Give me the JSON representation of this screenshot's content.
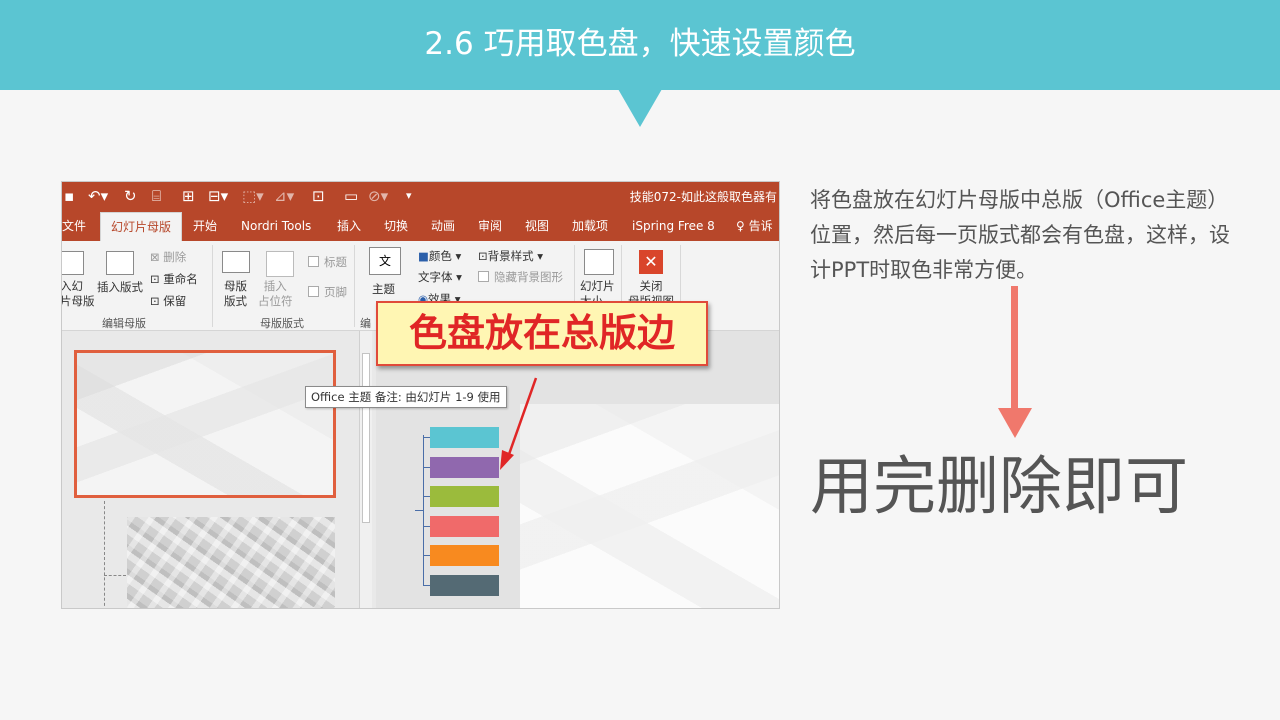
{
  "slide": {
    "title": "2.6 巧用取色盘，快速设置颜色",
    "description": "将色盘放在幻灯片母版中总版（Office主题） 位置，然后每一页版式都会有色盘，这样，设计PPT时取色非常方便。",
    "conclusion": "用完删除即可",
    "accent_color": "#5bc5d2",
    "arrow_color": "#f0786c"
  },
  "app": {
    "document_title": "技能072-如此这般取色器有",
    "quick_access": [
      "save-icon",
      "undo-icon",
      "redo-icon",
      "present-icon",
      "layout-icon",
      "format-painter-icon"
    ],
    "tabs": [
      {
        "label": "文件"
      },
      {
        "label": "幻灯片母版",
        "active": true
      },
      {
        "label": "开始"
      },
      {
        "label": "Nordri Tools"
      },
      {
        "label": "插入"
      },
      {
        "label": "切换"
      },
      {
        "label": "动画"
      },
      {
        "label": "审阅"
      },
      {
        "label": "视图"
      },
      {
        "label": "加载项"
      },
      {
        "label": "iSpring Free 8"
      },
      {
        "label": "告诉"
      }
    ],
    "ribbon": {
      "edit_master": {
        "group_label": "编辑母版",
        "insert_master": "入幻\n片母版",
        "insert_layout": "插入版式",
        "delete": "删除",
        "rename": "重命名",
        "preserve": "保留"
      },
      "master_layout": {
        "group_label": "母版版式",
        "master_layout_btn": "母版\n版式",
        "insert_placeholder": "插入\n占位符",
        "title_chk": "标题",
        "footer_chk": "页脚"
      },
      "edit_theme": {
        "group_label": "编",
        "theme": "主题",
        "colors": "颜色",
        "fonts": "字体",
        "effects": "效果",
        "bg_styles": "背景样式",
        "hide_bg": "隐藏背景图形"
      },
      "size": {
        "slide_size": "幻灯片\n大小"
      },
      "close": {
        "close_view": "关闭\n母版视图"
      }
    },
    "tooltip": "Office 主题 备注: 由幻灯片 1-9 使用",
    "callout": "色盘放在总版边",
    "palette": [
      "#5bc5d2",
      "#9068ae",
      "#9bbb3c",
      "#f06a6a",
      "#f88a1f",
      "#546a74"
    ]
  }
}
